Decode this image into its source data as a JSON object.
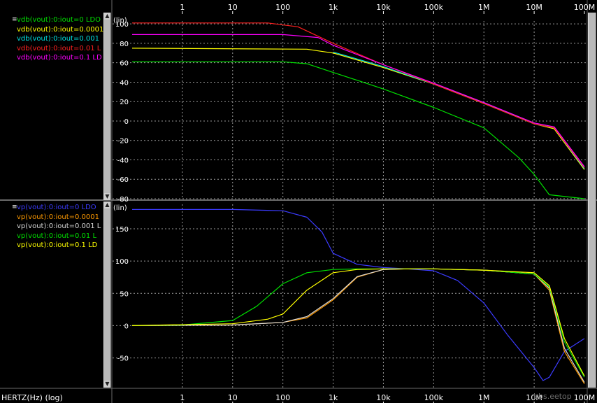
{
  "window": {
    "xaxis_title": "HERTZ(Hz) (log)",
    "watermark": "bbs.eetop"
  },
  "top_panel": {
    "scale_label": "(lin)",
    "legend": [
      {
        "label": "vdb(vout):0:iout=0  LDO",
        "color": "#00e000"
      },
      {
        "label": "vdb(vout):0:iout=0.0001",
        "color": "#ffff00"
      },
      {
        "label": "vdb(vout):0:iout=0.001",
        "color": "#00e0e0"
      },
      {
        "label": "vdb(vout):0:iout=0.01  L",
        "color": "#ff2020"
      },
      {
        "label": "vdb(vout):0:iout=0.1  LD",
        "color": "#ff00ff"
      }
    ]
  },
  "bottom_panel": {
    "scale_label": "(lin)",
    "legend": [
      {
        "label": "vp(vout):0:iout=0  LDO",
        "color": "#3b3bff"
      },
      {
        "label": "vp(vout):0:iout=0.0001",
        "color": "#ff9a00"
      },
      {
        "label": "vp(vout):0:iout=0.001  L",
        "color": "#d8d8d8"
      },
      {
        "label": "vp(vout):0:iout=0.01  L",
        "color": "#00e000"
      },
      {
        "label": "vp(vout):0:iout=0.1  LD",
        "color": "#ffff00"
      }
    ]
  },
  "chart_data": [
    {
      "type": "line",
      "xscale": "log",
      "xlim": [
        0.1,
        100000000
      ],
      "ylim": [
        -80,
        103
      ],
      "grid": true,
      "xticks": [
        1,
        10,
        100,
        1000,
        10000,
        100000,
        1000000,
        10000000,
        100000000
      ],
      "xtick_labels": [
        "1",
        "10",
        "100",
        "1k",
        "10k",
        "100k",
        "1M",
        "10M",
        "100M"
      ],
      "yticks": [
        100,
        80,
        60,
        40,
        20,
        0,
        -20,
        -40,
        -60,
        -80
      ],
      "ytick_labels": [
        "100",
        "80",
        "60",
        "40",
        "20",
        "0",
        "-20",
        "-40",
        "-60",
        "-80"
      ],
      "series": [
        {
          "name": "vdb(vout):0:iout=0",
          "color": "#00e000",
          "x": [
            0.1,
            100,
            300,
            1000,
            3000,
            10000,
            100000,
            1000000,
            5000000,
            10000000,
            20000000,
            100000000
          ],
          "y": [
            61,
            61,
            59,
            50,
            42,
            33,
            14,
            -7,
            -38,
            -55,
            -76,
            -80
          ]
        },
        {
          "name": "vdb(vout):0:iout=0.0001",
          "color": "#ffff00",
          "x": [
            0.1,
            300,
            1000,
            10000,
            100000,
            1000000,
            10000000,
            25000000,
            100000000
          ],
          "y": [
            75,
            74,
            70,
            55,
            38,
            18,
            -3,
            -8,
            -50
          ]
        },
        {
          "name": "vdb(vout):0:iout=0.001",
          "color": "#00e0e0",
          "x": [
            1000,
            10000,
            100000,
            1000000,
            10000000,
            25000000,
            100000000
          ],
          "y": [
            71,
            56,
            38,
            19,
            -3,
            -7,
            -49
          ]
        },
        {
          "name": "vdb(vout):0:iout=0.01",
          "color": "#ff2020",
          "x": [
            0.1,
            50,
            200,
            1000,
            10000,
            100000,
            1000000,
            10000000,
            25000000,
            100000000
          ],
          "y": [
            101,
            101,
            97,
            80,
            58,
            38,
            18,
            -3,
            -7,
            -48
          ]
        },
        {
          "name": "vdb(vout):0:iout=0.1",
          "color": "#ff00ff",
          "x": [
            0.1,
            100,
            500,
            1000,
            10000,
            100000,
            1000000,
            10000000,
            25000000,
            100000000
          ],
          "y": [
            89,
            89,
            86,
            78,
            58,
            39,
            19,
            -2,
            -6,
            -47
          ]
        }
      ]
    },
    {
      "type": "line",
      "xscale": "log",
      "xlim": [
        0.1,
        100000000
      ],
      "ylim": [
        -96,
        188
      ],
      "grid": true,
      "xticks": [
        1,
        10,
        100,
        1000,
        10000,
        100000,
        1000000,
        10000000,
        100000000
      ],
      "xtick_labels": [
        "1",
        "10",
        "100",
        "1k",
        "10k",
        "100k",
        "1M",
        "10M",
        "100M"
      ],
      "yticks": [
        150,
        100,
        50,
        0,
        -50
      ],
      "ytick_labels": [
        "150",
        "100",
        "50",
        "0",
        "-50"
      ],
      "series": [
        {
          "name": "vp(vout):0:iout=0",
          "color": "#3b3bff",
          "x": [
            0.1,
            10,
            100,
            300,
            600,
            1000,
            3000,
            10000,
            30000,
            100000,
            300000,
            1000000,
            3000000,
            10000000,
            15000000,
            20000000,
            40000000,
            100000000
          ],
          "y": [
            180,
            180,
            178,
            168,
            145,
            112,
            95,
            90,
            88,
            85,
            70,
            35,
            -15,
            -65,
            -85,
            -80,
            -40,
            -20
          ]
        },
        {
          "name": "vp(vout):0:iout=0.0001",
          "color": "#ff9a00",
          "x": [
            0.1,
            10,
            100,
            300,
            1000,
            3000,
            10000,
            30000,
            100000,
            1000000,
            10000000,
            20000000,
            40000000,
            100000000
          ],
          "y": [
            0,
            1,
            5,
            12,
            40,
            75,
            87,
            88,
            88,
            86,
            80,
            55,
            -40,
            -90
          ]
        },
        {
          "name": "vp(vout):0:iout=0.001",
          "color": "#d8d8d8",
          "x": [
            0.1,
            10,
            100,
            300,
            1000,
            3000,
            10000,
            30000,
            100000,
            1000000,
            10000000,
            20000000,
            40000000,
            100000000
          ],
          "y": [
            0,
            1,
            5,
            14,
            42,
            76,
            87,
            88,
            88,
            86,
            80,
            58,
            -35,
            -88
          ]
        },
        {
          "name": "vp(vout):0:iout=0.01",
          "color": "#00e000",
          "x": [
            0.1,
            1,
            10,
            30,
            100,
            300,
            1000,
            3000,
            10000,
            100000,
            1000000,
            10000000,
            20000000,
            40000000,
            100000000
          ],
          "y": [
            0,
            1,
            8,
            30,
            65,
            82,
            87,
            88,
            88,
            88,
            86,
            80,
            60,
            -25,
            -80
          ]
        },
        {
          "name": "vp(vout):0:iout=0.1",
          "color": "#ffff00",
          "x": [
            0.1,
            10,
            50,
            100,
            300,
            1000,
            3000,
            10000,
            100000,
            1000000,
            10000000,
            20000000,
            40000000,
            100000000
          ],
          "y": [
            0,
            3,
            10,
            18,
            55,
            82,
            87,
            88,
            88,
            86,
            82,
            62,
            -20,
            -78
          ]
        }
      ]
    }
  ]
}
